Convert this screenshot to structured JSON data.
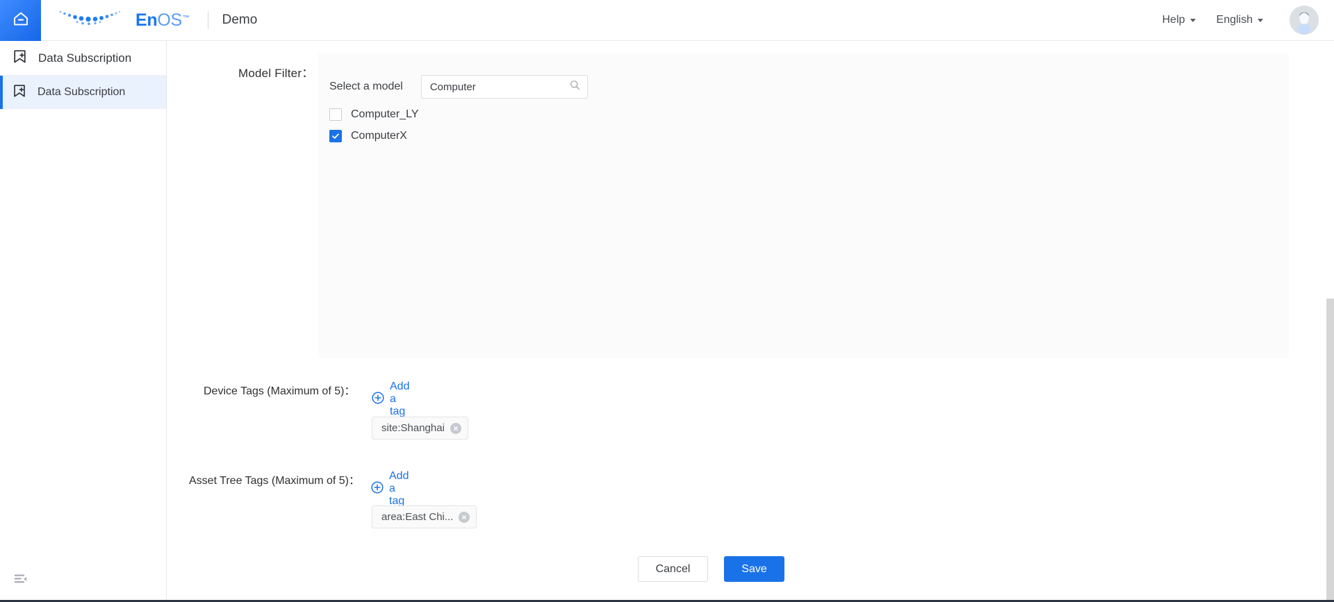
{
  "topbar": {
    "home_icon": "home-icon",
    "brand": {
      "en": "En",
      "os": "OS",
      "tm": "™"
    },
    "divider": "|",
    "product": "Demo",
    "help": "Help",
    "language": "English",
    "avatar": "user-avatar"
  },
  "sidebar": {
    "group": {
      "label": "Data Subscription",
      "icon": "bookmark-plus-icon"
    },
    "items": [
      {
        "label": "Data Subscription",
        "icon": "bookmark-plus-icon",
        "active": true
      }
    ],
    "collapse_icon": "collapse-sidebar-icon"
  },
  "form": {
    "model_filter": {
      "label": "Model Filter：",
      "select_label": "Select a model",
      "search_value": "Computer",
      "search_placeholder": "Search",
      "search_icon": "search-icon",
      "options": [
        {
          "label": "Computer_LY",
          "checked": false
        },
        {
          "label": "ComputerX",
          "checked": true
        }
      ]
    },
    "device_tags": {
      "label": "Device Tags (Maximum of 5)：",
      "add_label": "Add a tag",
      "add_icon": "plus-circle-icon",
      "chips": [
        {
          "text": "site:Shanghai",
          "remove_icon": "close-circle-icon"
        }
      ]
    },
    "asset_tree_tags": {
      "label": "Asset Tree Tags (Maximum of 5)：",
      "add_label": "Add a tag",
      "add_icon": "plus-circle-icon",
      "chips": [
        {
          "text": "area:East Chi...",
          "remove_icon": "close-circle-icon"
        }
      ]
    },
    "buttons": {
      "cancel": "Cancel",
      "save": "Save"
    }
  },
  "colors": {
    "accent": "#1a72e8",
    "sidebar_active_bg": "#eaf2fe",
    "panel_bg": "#fbfbfb",
    "text": "#2e3033"
  }
}
